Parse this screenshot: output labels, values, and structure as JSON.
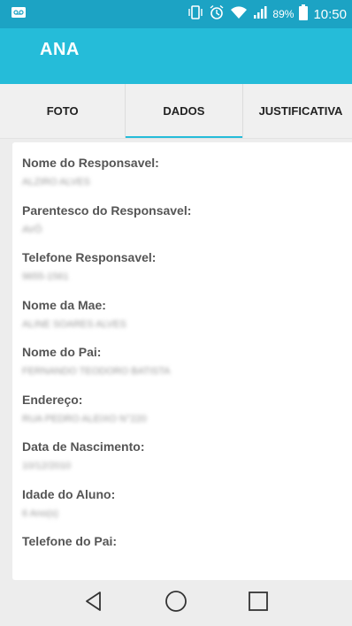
{
  "status_bar": {
    "battery_percent": "89%",
    "time": "10:50",
    "icons": [
      "voicemail-icon",
      "phone-vibrate-icon",
      "alarm-icon",
      "wifi-icon",
      "signal-icon",
      "battery-icon"
    ]
  },
  "app_bar": {
    "title": "ANA"
  },
  "tabs": [
    {
      "label": "FOTO",
      "active": false
    },
    {
      "label": "DADOS",
      "active": true
    },
    {
      "label": "JUSTIFICATIVA",
      "active": false
    }
  ],
  "fields": [
    {
      "label": "Nome do Responsavel:",
      "value": "ALZIRO ALVES"
    },
    {
      "label": "Parentesco do Responsavel:",
      "value": "AVÔ"
    },
    {
      "label": "Telefone Responsavel:",
      "value": "9655-1561"
    },
    {
      "label": "Nome da Mae:",
      "value": "ALINE SOARES ALVES"
    },
    {
      "label": "Nome do Pai:",
      "value": "FERNANDO TEODORO BATISTA"
    },
    {
      "label": "Endereço:",
      "value": "RUA PEDRO ALEIXO N°220"
    },
    {
      "label": "Data de Nascimento:",
      "value": "10/12/2010"
    },
    {
      "label": "Idade do Aluno:",
      "value": "6 Ano(s)"
    },
    {
      "label": "Telefone do Pai:",
      "value": ""
    }
  ],
  "nav_bar": {
    "icons": [
      "back-icon",
      "home-icon",
      "recents-icon"
    ]
  },
  "colors": {
    "status_bar": "#1ca3c4",
    "app_bar": "#25bcd9",
    "tab_indicator": "#25bcd9"
  }
}
